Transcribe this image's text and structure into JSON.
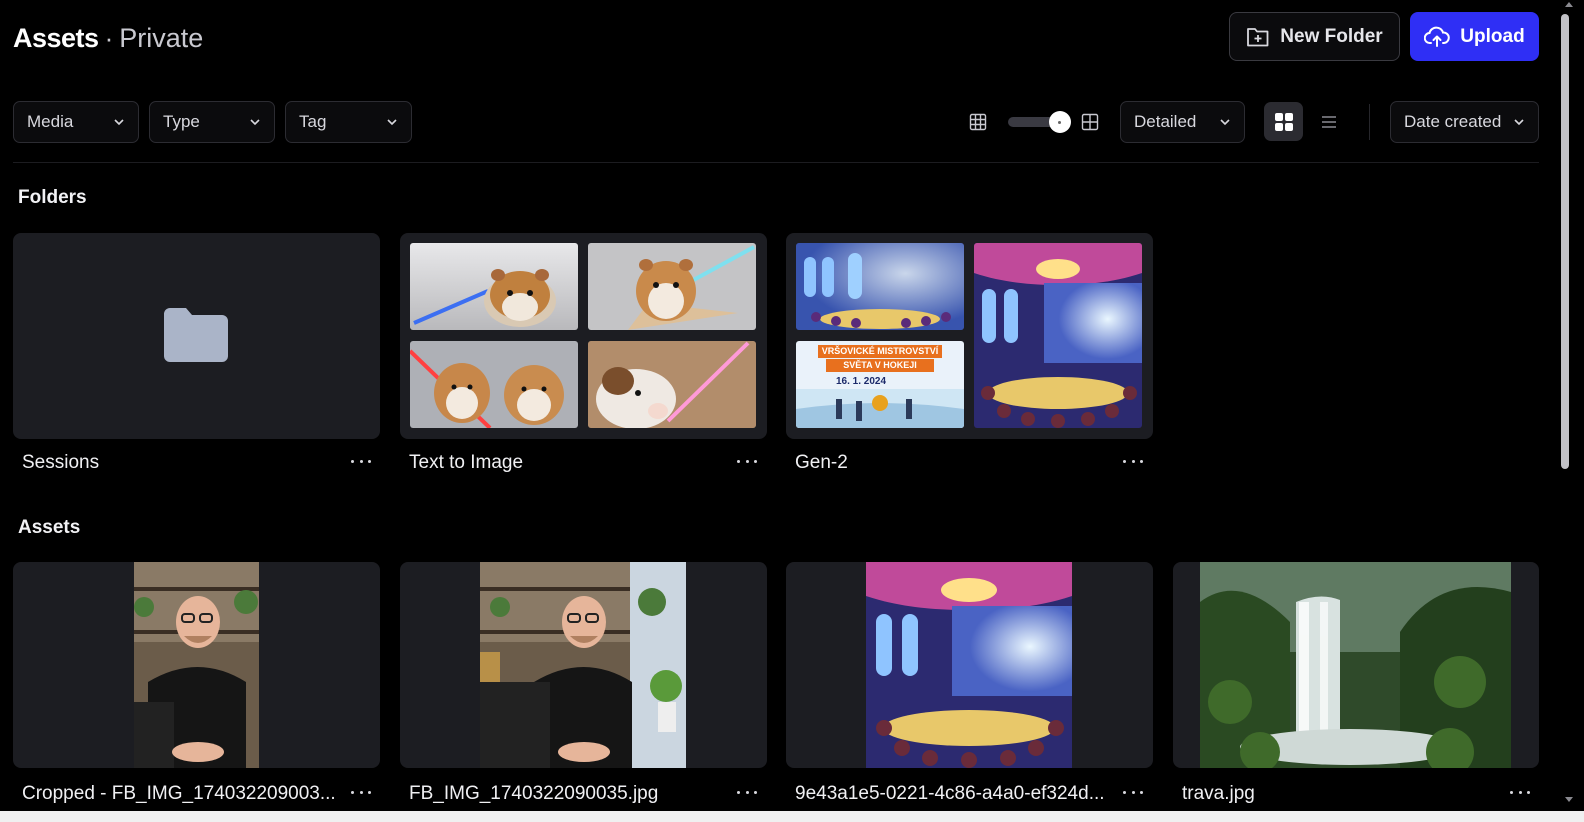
{
  "header": {
    "title": "Assets",
    "separator": "·",
    "subtitle": "Private"
  },
  "actions": {
    "new_folder_label": "New Folder",
    "upload_label": "Upload"
  },
  "filters": [
    {
      "label": "Media"
    },
    {
      "label": "Type"
    },
    {
      "label": "Tag"
    }
  ],
  "view": {
    "mode_label": "Detailed",
    "sort_label": "Date created",
    "size_slider_fraction": 0.8,
    "active_layout": "grid"
  },
  "sections": {
    "folders_title": "Folders",
    "assets_title": "Assets"
  },
  "folders": [
    {
      "name": "Sessions"
    },
    {
      "name": "Text to Image"
    },
    {
      "name": "Gen-2"
    }
  ],
  "gen2_poster": {
    "line1": "VRŠOVICKÉ MISTROVSTVÍ",
    "line2": "SVĚTA V HOKEJI",
    "date": "16. 1. 2024"
  },
  "assets": [
    {
      "name": "Cropped - FB_IMG_174032209003..."
    },
    {
      "name": "FB_IMG_1740322090035.jpg"
    },
    {
      "name": "9e43a1e5-0221-4c86-a4a0-ef324d..."
    },
    {
      "name": "trava.jpg"
    }
  ],
  "colors": {
    "accent": "#2f2ff5",
    "card_bg": "#1c1d22",
    "folder_icon": "#aab4c8"
  }
}
